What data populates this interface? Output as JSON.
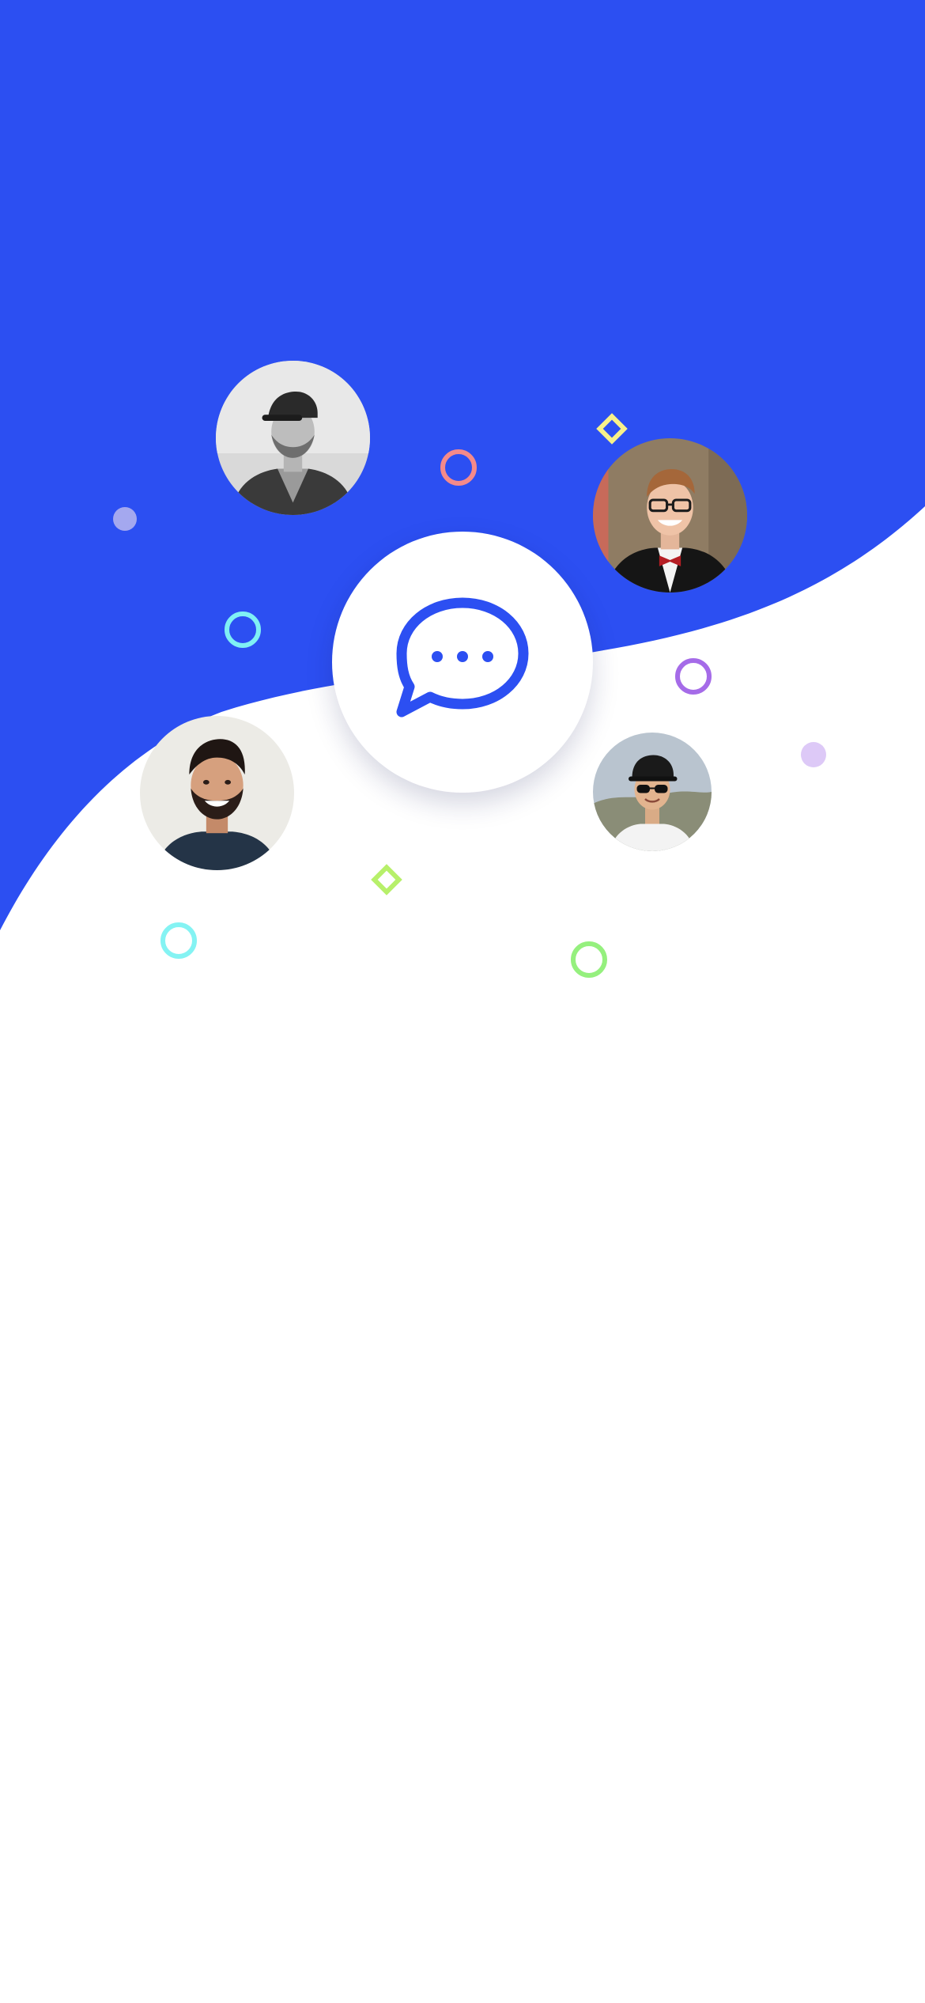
{
  "screen": {
    "background_color": "#ffffff",
    "hero_color": "#2c4ff2"
  },
  "people": [
    {
      "name": "person-cap-grey-jacket",
      "style": "monochrome"
    },
    {
      "name": "person-glasses-bowtie",
      "style": "color"
    },
    {
      "name": "person-smiling-beard",
      "style": "color"
    },
    {
      "name": "person-cap-sunglasses",
      "style": "color"
    }
  ],
  "center_icon": {
    "icon": "chat-bubble-ellipsis-icon",
    "color": "#2c4ff2"
  },
  "decorations": {
    "colors": [
      "#f58a8a",
      "#7ff0f5",
      "#a56be8",
      "#84f3f3",
      "#95f07e",
      "#a4a8ef",
      "#ddc9f7",
      "#f7f08a",
      "#b7f06a"
    ]
  }
}
